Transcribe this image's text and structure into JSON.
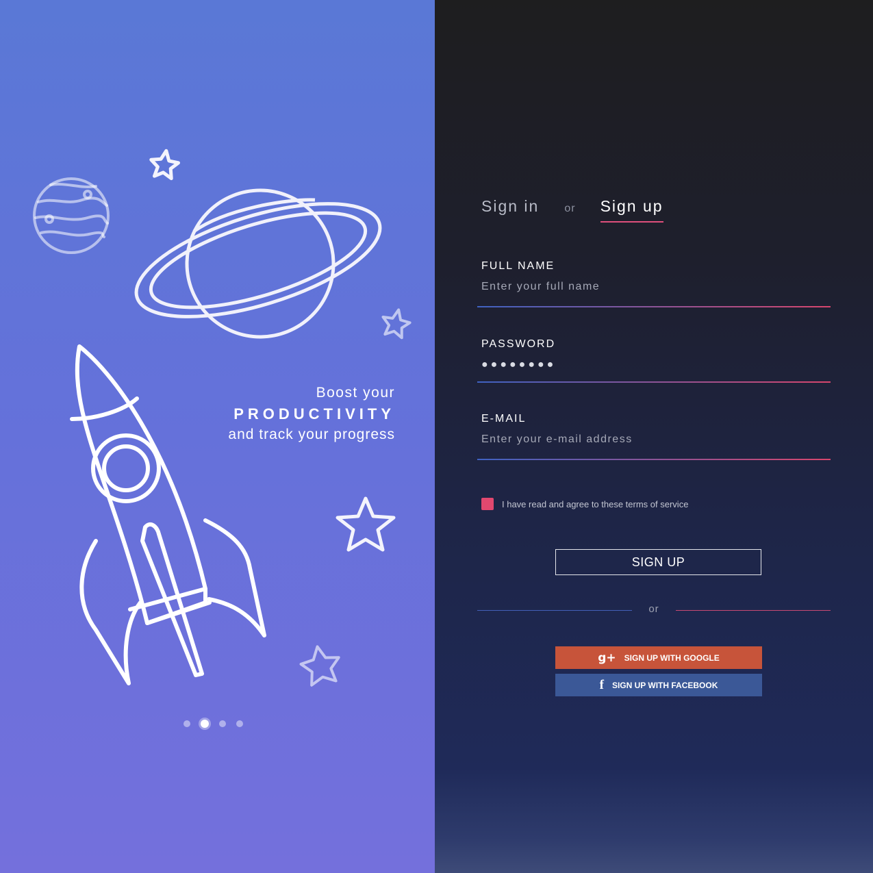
{
  "hero": {
    "line1": "Boost your",
    "line2": "PRODUCTIVITY",
    "line3": "and track your progress",
    "carousel": {
      "count": 4,
      "active_index": 1
    }
  },
  "auth": {
    "tab_signin": "Sign in",
    "tab_or": "or",
    "tab_signup": "Sign up",
    "active_tab": "signup",
    "fields": {
      "fullname": {
        "label": "FULL NAME",
        "placeholder": "Enter your full name"
      },
      "password": {
        "label": "PASSWORD",
        "value": "●●●●●●●●"
      },
      "email": {
        "label": "E-MAIL",
        "placeholder": "Enter your e-mail address"
      }
    },
    "terms": {
      "text": "I have read and agree to these terms of service",
      "checked": true
    },
    "signup_button": "SIGN UP",
    "divider_or": "or",
    "google_button": "SIGN UP WITH GOOGLE",
    "google_icon_glyph": "g+",
    "facebook_button": "SIGN UP WITH FACEBOOK",
    "facebook_icon_glyph": "f"
  },
  "colors": {
    "accent": "#e1486f",
    "google": "#c7543a",
    "facebook": "#3b5897",
    "left_panel_top": "#5a78d6",
    "left_panel_bottom": "#7470dc"
  }
}
